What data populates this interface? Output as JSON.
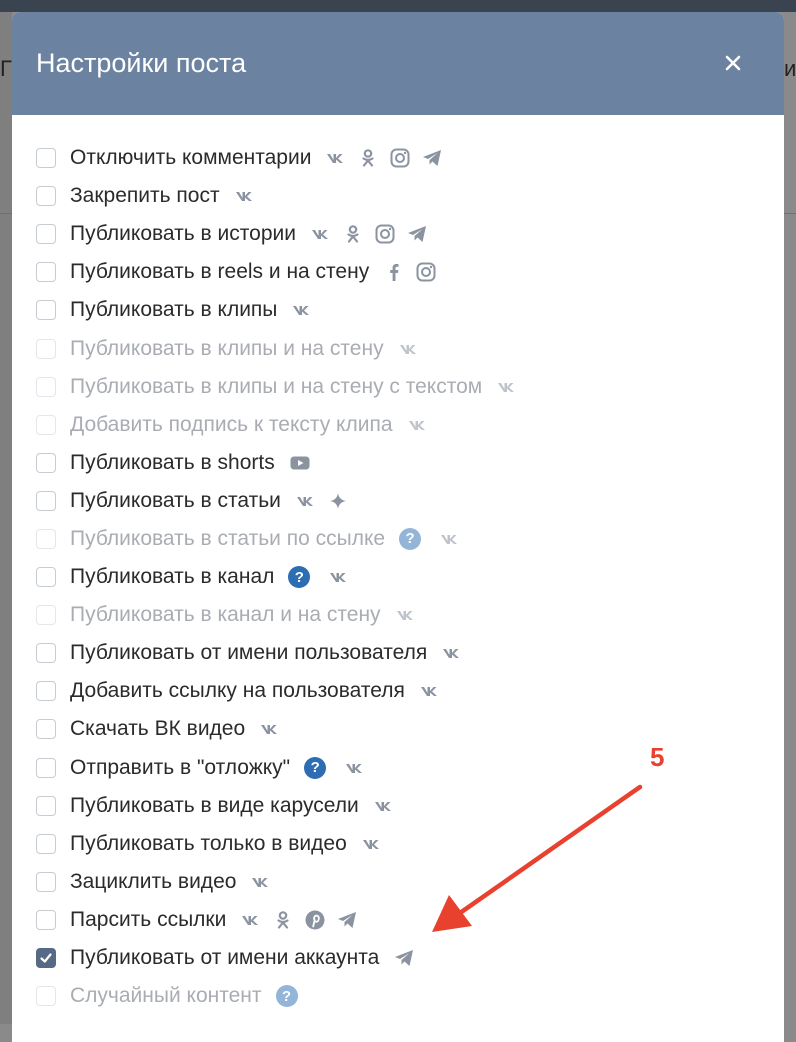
{
  "modal": {
    "title": "Настройки поста",
    "close_symbol": "×"
  },
  "background": {
    "left_char": "Г",
    "right_char": "и"
  },
  "options": [
    {
      "label": "Отключить комментарии",
      "checked": false,
      "disabled": false,
      "help": null,
      "icons": [
        "vk-icon",
        "ok-icon",
        "instagram-icon",
        "telegram-icon"
      ]
    },
    {
      "label": "Закрепить пост",
      "checked": false,
      "disabled": false,
      "help": null,
      "icons": [
        "vk-icon"
      ]
    },
    {
      "label": "Публиковать в истории",
      "checked": false,
      "disabled": false,
      "help": null,
      "icons": [
        "vk-icon",
        "ok-icon",
        "instagram-icon",
        "telegram-icon"
      ]
    },
    {
      "label": "Публиковать в reels и на стену",
      "checked": false,
      "disabled": false,
      "help": null,
      "icons": [
        "facebook-icon",
        "instagram-icon"
      ]
    },
    {
      "label": "Публиковать в клипы",
      "checked": false,
      "disabled": false,
      "help": null,
      "icons": [
        "vk-icon"
      ]
    },
    {
      "label": "Публиковать в клипы и на стену",
      "checked": false,
      "disabled": true,
      "help": null,
      "icons": [
        "vk-icon"
      ]
    },
    {
      "label": "Публиковать в клипы и на стену с текстом",
      "checked": false,
      "disabled": true,
      "help": null,
      "icons": [
        "vk-icon"
      ]
    },
    {
      "label": "Добавить подпись к тексту клипа",
      "checked": false,
      "disabled": true,
      "help": null,
      "icons": [
        "vk-icon"
      ]
    },
    {
      "label": "Публиковать в shorts",
      "checked": false,
      "disabled": false,
      "help": null,
      "icons": [
        "youtube-icon"
      ]
    },
    {
      "label": "Публиковать в статьи",
      "checked": false,
      "disabled": false,
      "help": null,
      "icons": [
        "vk-icon",
        "sparkle-icon"
      ]
    },
    {
      "label": "Публиковать в статьи по ссылке",
      "checked": false,
      "disabled": true,
      "help": "light",
      "icons": [
        "vk-icon"
      ]
    },
    {
      "label": "Публиковать в канал",
      "checked": false,
      "disabled": false,
      "help": "dark",
      "icons": [
        "vk-icon"
      ]
    },
    {
      "label": "Публиковать в канал и на стену",
      "checked": false,
      "disabled": true,
      "help": null,
      "icons": [
        "vk-icon"
      ]
    },
    {
      "label": "Публиковать от имени пользователя",
      "checked": false,
      "disabled": false,
      "help": null,
      "icons": [
        "vk-icon"
      ]
    },
    {
      "label": "Добавить ссылку на пользователя",
      "checked": false,
      "disabled": false,
      "help": null,
      "icons": [
        "vk-icon"
      ]
    },
    {
      "label": "Скачать ВК видео",
      "checked": false,
      "disabled": false,
      "help": null,
      "icons": [
        "vk-icon"
      ]
    },
    {
      "label": "Отправить в \"отложку\"",
      "checked": false,
      "disabled": false,
      "help": "dark",
      "icons": [
        "vk-icon"
      ]
    },
    {
      "label": "Публиковать в виде карусели",
      "checked": false,
      "disabled": false,
      "help": null,
      "icons": [
        "vk-icon"
      ]
    },
    {
      "label": "Публиковать только в видео",
      "checked": false,
      "disabled": false,
      "help": null,
      "icons": [
        "vk-icon"
      ]
    },
    {
      "label": "Зациклить видео",
      "checked": false,
      "disabled": false,
      "help": null,
      "icons": [
        "vk-icon"
      ]
    },
    {
      "label": "Парсить ссылки",
      "checked": false,
      "disabled": false,
      "help": null,
      "icons": [
        "vk-icon",
        "ok-icon",
        "pinterest-icon",
        "telegram-icon"
      ]
    },
    {
      "label": "Публиковать от имени аккаунта",
      "checked": true,
      "disabled": false,
      "help": null,
      "icons": [
        "telegram-icon"
      ]
    },
    {
      "label": "Случайный контент",
      "checked": false,
      "disabled": true,
      "help": "light",
      "icons": []
    }
  ],
  "help_symbol": "?",
  "annotation": {
    "label": "5",
    "color": "#e8412e"
  },
  "colors": {
    "header": "#6b82a0",
    "checked": "#566a85",
    "icon": "#8b93a1"
  }
}
